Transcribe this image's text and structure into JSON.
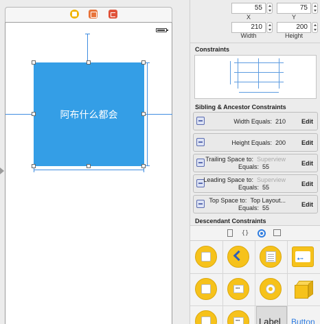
{
  "canvas": {
    "view_label": "阿布什么都会"
  },
  "inspector": {
    "x_value": "55",
    "y_value": "75",
    "x_label": "X",
    "y_label": "Y",
    "width_value": "210",
    "height_value": "200",
    "width_label": "Width",
    "height_label": "Height",
    "constraints_title": "Constraints",
    "sibling_title": "Sibling & Ancestor Constraints",
    "descendant_title": "Descendant Constraints",
    "constraints": [
      {
        "line1": "Width Equals:",
        "value1": "210",
        "edit": "Edit"
      },
      {
        "line1": "Height Equals:",
        "value1": "200",
        "edit": "Edit"
      },
      {
        "line1": "Trailing Space to:",
        "sub1": "Superview",
        "line2": "Equals:",
        "value2": "55",
        "edit": "Edit"
      },
      {
        "line1": "Leading Space to:",
        "sub1": "Superview",
        "line2": "Equals:",
        "value2": "55",
        "edit": "Edit"
      },
      {
        "line1": "Top Space to:",
        "value1": "Top Layout...",
        "line2": "Equals:",
        "value2": "55",
        "edit": "Edit"
      }
    ]
  },
  "library": {
    "tab_braces": "{}",
    "label_item": "Label",
    "button_item": "Button"
  },
  "colors": {
    "view_blue": "#349ee6",
    "constraint_blue": "#3e8ce0",
    "library_yellow": "#f6c21b"
  }
}
